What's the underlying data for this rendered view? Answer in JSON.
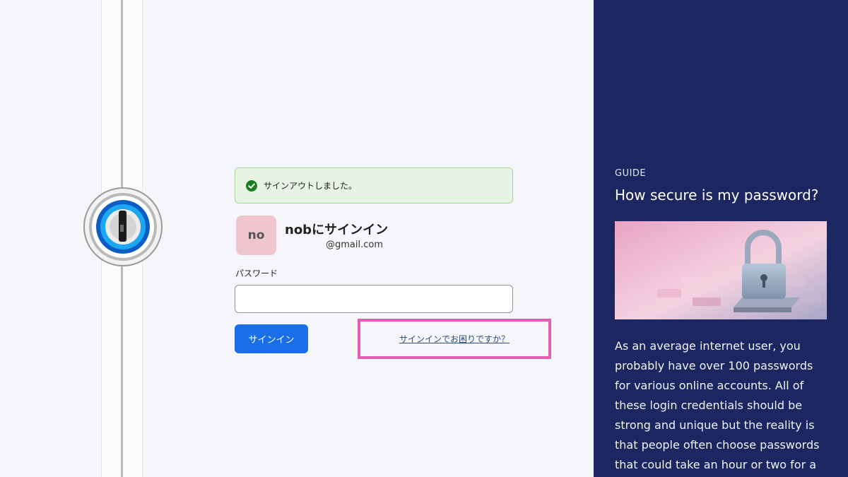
{
  "alert": {
    "text": "サインアウトしました。",
    "icon": "check-circle-icon",
    "color": "#1e7d23"
  },
  "account": {
    "avatar_initials": "no",
    "title": "nobにサインイン",
    "email": "@gmail.com"
  },
  "password": {
    "label": "パスワード",
    "value": "",
    "placeholder": ""
  },
  "actions": {
    "signin_label": "サインイン",
    "help_link": "サインインでお困りですか？"
  },
  "guide": {
    "kicker": "GUIDE",
    "title": "How secure is my password?",
    "image_icon": "padlock-illustration",
    "body": "As an average internet user, you probably have over 100 passwords for various online accounts. All of these login credentials should be strong and unique but the reality is that people often choose passwords that could take an hour or two for a"
  },
  "colors": {
    "primary_button": "#1a6fe8",
    "highlight_border": "#e55fb4",
    "guide_background": "#1c2660",
    "alert_background": "#e7f4e3"
  }
}
